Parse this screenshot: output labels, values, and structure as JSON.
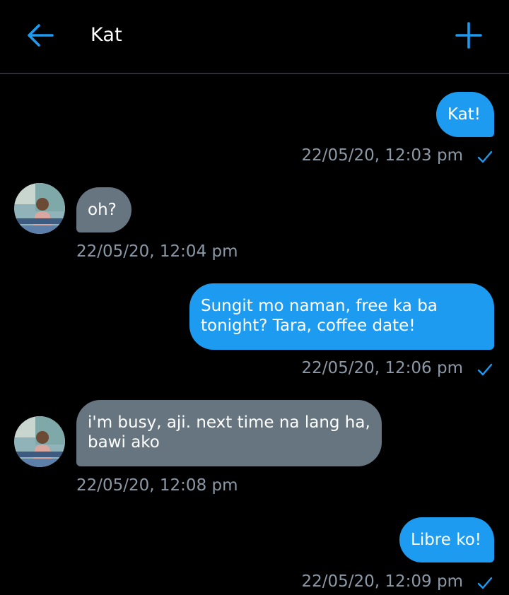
{
  "header": {
    "title": "Kat",
    "back_icon": "arrow-left-icon",
    "action_icon": "plus-icon"
  },
  "colors": {
    "accent": "#1d9bf0",
    "incoming_bubble": "#66757f",
    "timestamp": "#8b98a5",
    "background": "#000000"
  },
  "messages": [
    {
      "direction": "outgoing",
      "text": "Kat!",
      "time": "22/05/20, 12:03 pm",
      "read": true
    },
    {
      "direction": "incoming",
      "text": "oh?",
      "time": "22/05/20, 12:04 pm"
    },
    {
      "direction": "outgoing",
      "text": "Sungit mo naman, free ka ba tonight? Tara, coffee date!",
      "time": "22/05/20, 12:06 pm",
      "read": true
    },
    {
      "direction": "incoming",
      "text": "i'm busy, aji. next time na lang ha, bawi ako",
      "time": "22/05/20, 12:08 pm"
    },
    {
      "direction": "outgoing",
      "text": "Libre ko!",
      "time": "22/05/20, 12:09 pm",
      "read": true
    }
  ]
}
